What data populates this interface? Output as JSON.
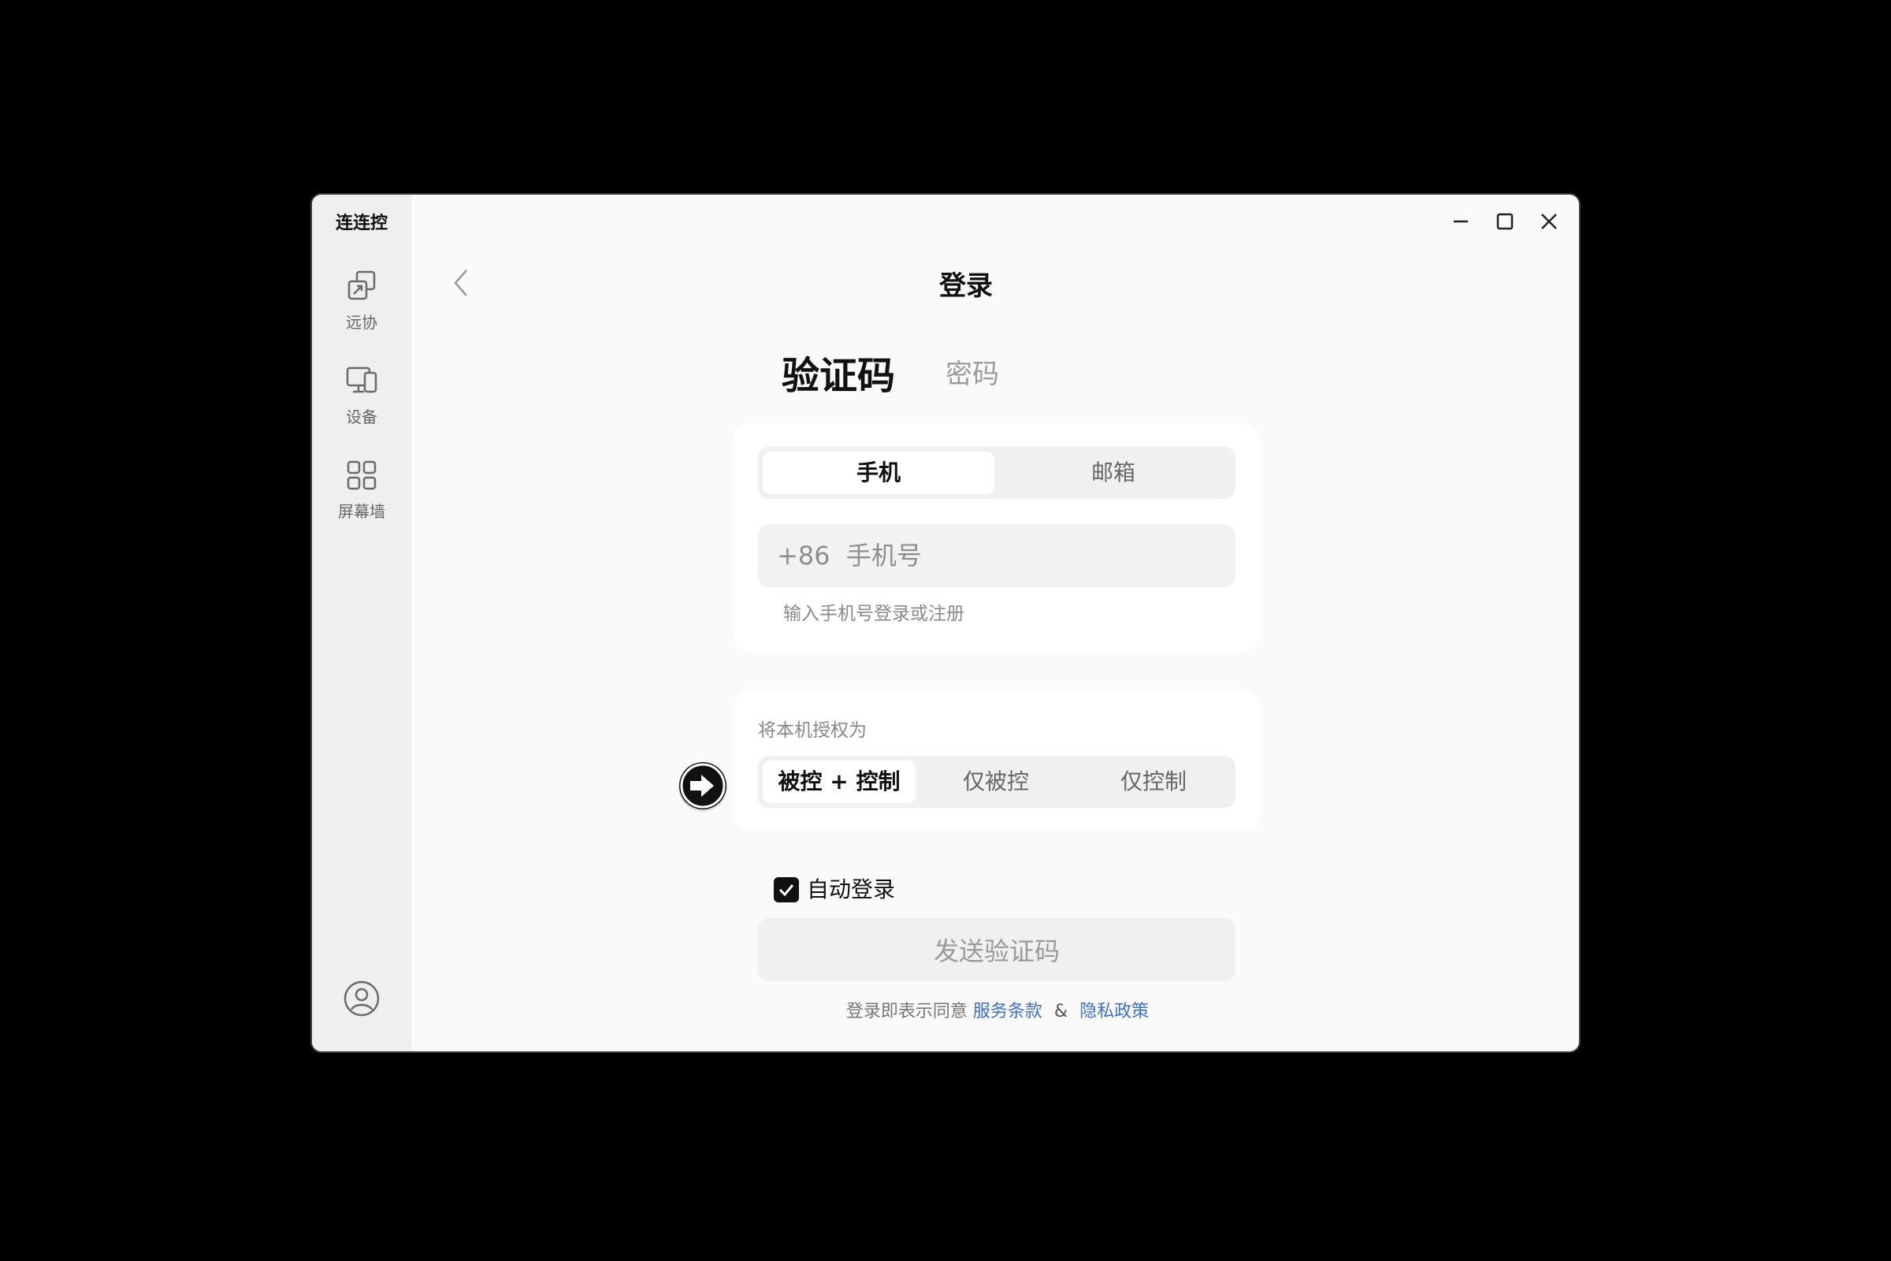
{
  "app": {
    "title": "连连控"
  },
  "sidebar": {
    "items": [
      {
        "label": "远协",
        "icon": "remote-assist-icon"
      },
      {
        "label": "设备",
        "icon": "device-icon"
      },
      {
        "label": "屏幕墙",
        "icon": "screen-wall-icon"
      }
    ],
    "avatar_icon": "user-avatar-icon"
  },
  "window_controls": {
    "minimize_icon": "minimize-icon",
    "maximize_icon": "maximize-icon",
    "close_icon": "close-icon"
  },
  "header": {
    "title": "登录",
    "back_icon": "chevron-left-icon"
  },
  "login_methods": {
    "active": "验证码",
    "items": [
      "验证码",
      "密码"
    ]
  },
  "account_card": {
    "segments": [
      "手机",
      "邮箱"
    ],
    "selected": "手机",
    "phone_input": {
      "value": "",
      "placeholder": "+86  手机号"
    },
    "hint": "输入手机号登录或注册"
  },
  "auth_card": {
    "label": "将本机授权为",
    "options": [
      "被控 + 控制",
      "仅被控",
      "仅控制"
    ],
    "selected": "被控 + 控制"
  },
  "auto_login": {
    "label": "自动登录",
    "checked": true
  },
  "send_button": {
    "label": "发送验证码"
  },
  "agreement": {
    "prefix": "登录即表示同意",
    "terms": "服务条款",
    "amp": "&",
    "privacy": "隐私政策",
    "link_color": "#3a6fd8"
  }
}
